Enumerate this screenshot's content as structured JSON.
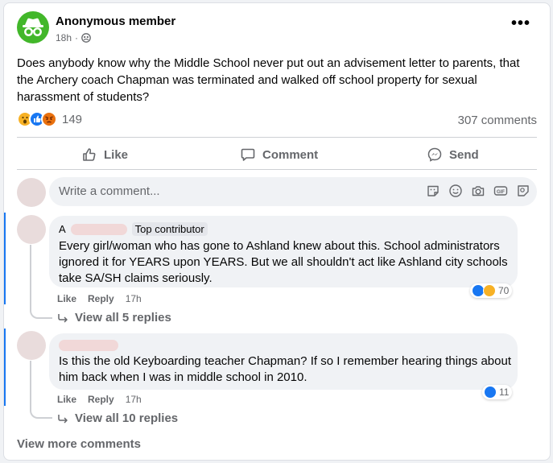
{
  "post": {
    "author": "Anonymous member",
    "time": "18h",
    "separator": "·",
    "text": "Does anybody know why the Middle School never put out an advisement letter to parents, that the Archery coach Chapman was terminated and walked off school property for sexual harassment of students?",
    "reaction_count": "149",
    "comment_count": "307 comments",
    "reaction_icons": [
      "wow-reaction-icon",
      "like-reaction-icon",
      "angry-reaction-icon"
    ]
  },
  "actions": {
    "like": "Like",
    "comment": "Comment",
    "send": "Send"
  },
  "composer": {
    "placeholder": "Write a comment...",
    "icons": [
      "sticker-icon",
      "emoji-icon",
      "camera-icon",
      "gif-icon",
      "avatar-sticker-icon"
    ]
  },
  "comments": [
    {
      "author_prefix": "A",
      "badge": "Top contributor",
      "text": "Every girl/woman who has gone to Ashland knew about this. School administrators ignored it for YEARS upon YEARS. But we all shouldn't act like Ashland city schools take SA/SH claims seriously.",
      "like": "Like",
      "reply": "Reply",
      "time": "17h",
      "reaction_count": "70",
      "reaction_icons": [
        "like-reaction-icon",
        "care-reaction-icon"
      ],
      "view_replies": "View all 5 replies"
    },
    {
      "text": "Is this the old Keyboarding teacher Chapman? If so I remember hearing things about him back when I was in middle school in 2010.",
      "like": "Like",
      "reply": "Reply",
      "time": "17h",
      "reaction_count": "11",
      "reaction_icons": [
        "like-reaction-icon"
      ],
      "view_replies": "View all 10 replies"
    }
  ],
  "view_more": "View more comments",
  "colors": {
    "accent": "#1877f2",
    "secondary_text": "#65676b",
    "avatar_green": "#42b72a"
  }
}
